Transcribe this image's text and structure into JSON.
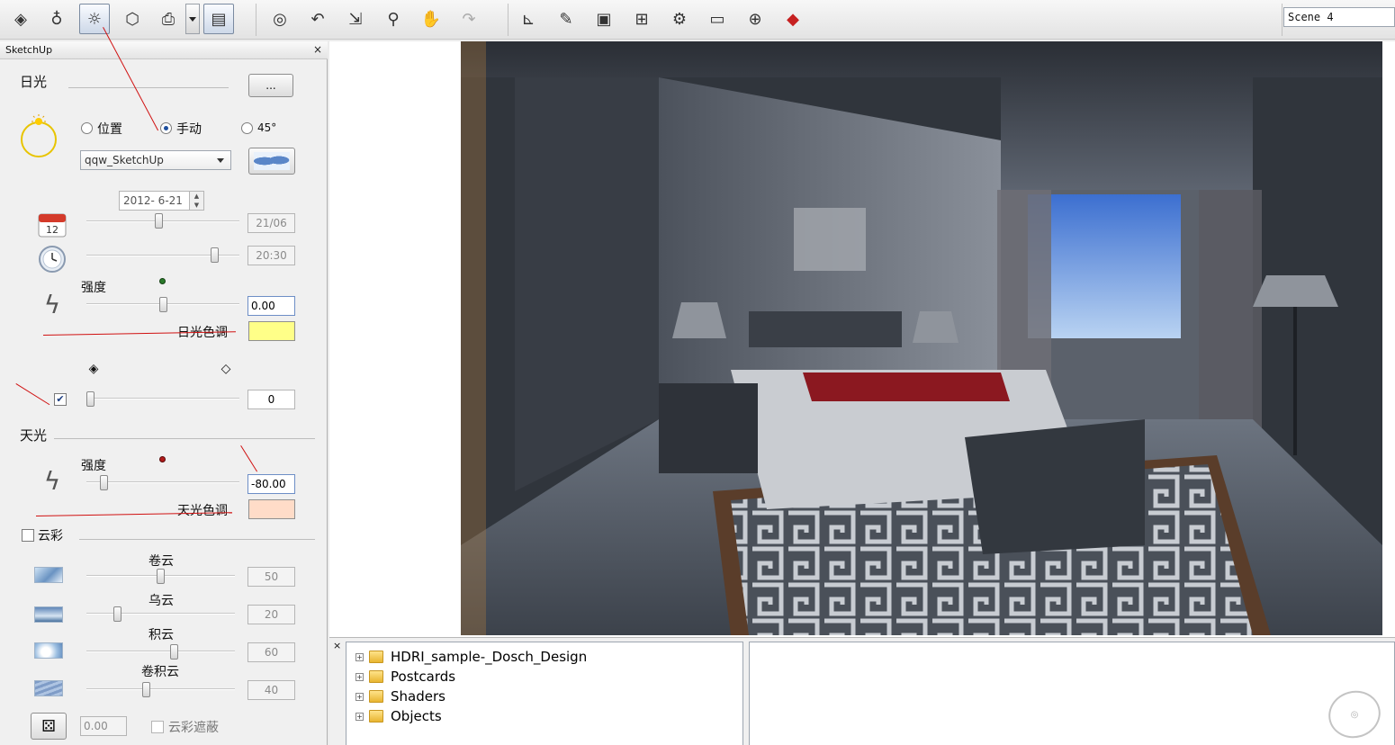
{
  "toolbar": {
    "scene_select": "Scene 4"
  },
  "panel": {
    "title": "SketchUp",
    "close": "×",
    "sunlight": {
      "label": "日光",
      "more_button": "...",
      "radio_location": "位置",
      "radio_manual": "手动",
      "radio_45": "45°",
      "selected_mode": "手动",
      "location_combo": "qqw_SketchUp",
      "date": "2012-  6-21",
      "date_readout": "21/06",
      "time_readout": "20:30",
      "intensity_label": "强度",
      "intensity_value": "0.00",
      "color_label": "日光色调",
      "color": "#ffff88",
      "shadow_value": "0",
      "shadow_checked": true
    },
    "skylight": {
      "label": "天光",
      "intensity_label": "强度",
      "intensity_value": "-80.00",
      "color_label": "天光色调",
      "color": "#ffdcc8"
    },
    "clouds": {
      "label": "云彩",
      "checked": false,
      "items": [
        {
          "label": "卷云",
          "value": "50"
        },
        {
          "label": "乌云",
          "value": "20"
        },
        {
          "label": "积云",
          "value": "60"
        },
        {
          "label": "卷积云",
          "value": "40"
        }
      ],
      "random_value": "0.00",
      "cloud_mask_label": "云彩遮蔽"
    }
  },
  "browser": {
    "close": "×",
    "tree": [
      {
        "label": "HDRI_sample-_Dosch_Design"
      },
      {
        "label": "Postcards"
      },
      {
        "label": "Shaders"
      },
      {
        "label": "Objects"
      }
    ]
  }
}
